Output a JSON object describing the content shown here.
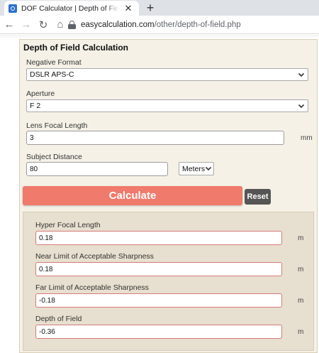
{
  "browser": {
    "tab_title": "DOF Calculator | Depth of Field C",
    "tab_close": "✕",
    "new_tab": "+",
    "back": "←",
    "forward": "→",
    "reload": "↻",
    "home": "⌂",
    "url_domain": "easycalculation.com",
    "url_path": "/other/depth-of-field.php"
  },
  "form": {
    "title": "Depth of Field Calculation",
    "negative_format_label": "Negative Format",
    "negative_format_value": "DSLR APS-C",
    "aperture_label": "Aperture",
    "aperture_value": "F 2",
    "focal_length_label": "Lens Focal Length",
    "focal_length_value": "3",
    "focal_length_unit": "mm",
    "subject_distance_label": "Subject Distance",
    "subject_distance_value": "80",
    "distance_unit_value": "Meters",
    "calculate_label": "Calculate",
    "reset_label": "Reset"
  },
  "results": {
    "hyper_focal_label": "Hyper Focal Length",
    "hyper_focal_value": "0.18",
    "near_limit_label": "Near Limit of Acceptable Sharpness",
    "near_limit_value": "0.18",
    "far_limit_label": "Far Limit of Acceptable Sharpness",
    "far_limit_value": "-0.18",
    "depth_of_field_label": "Depth of Field",
    "depth_of_field_value": "-0.36",
    "unit": "m"
  },
  "colors": {
    "calculate_button": "#f07a6c",
    "reset_button": "#555555",
    "panel_background": "#f5f1e7",
    "results_background": "#e7dfcf"
  }
}
